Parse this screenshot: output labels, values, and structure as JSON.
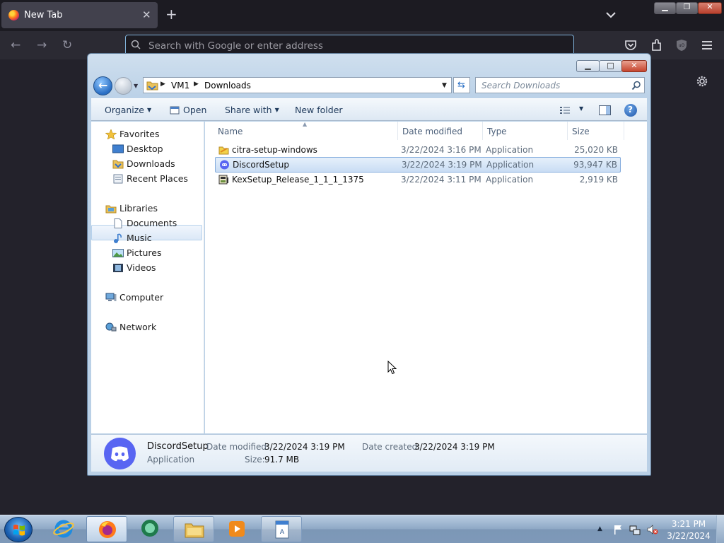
{
  "browser": {
    "tab_title": "New Tab",
    "tab_close": "✕",
    "new_tab": "+",
    "url_placeholder": "Search with Google or enter address"
  },
  "explorer": {
    "breadcrumb": [
      "VM1",
      "Downloads"
    ],
    "search_placeholder": "Search Downloads",
    "toolbar": {
      "organize": "Organize",
      "open": "Open",
      "share_with": "Share with",
      "new_folder": "New folder"
    },
    "nav": {
      "favorites": "Favorites",
      "desktop": "Desktop",
      "downloads": "Downloads",
      "recent_places": "Recent Places",
      "libraries": "Libraries",
      "documents": "Documents",
      "music": "Music",
      "pictures": "Pictures",
      "videos": "Videos",
      "computer": "Computer",
      "network": "Network"
    },
    "columns": [
      "Name",
      "Date modified",
      "Type",
      "Size"
    ],
    "files": [
      {
        "name": "citra-setup-windows",
        "date": "3/22/2024 3:16 PM",
        "type": "Application",
        "size": "25,020 KB",
        "icon": "citra-icon"
      },
      {
        "name": "DiscordSetup",
        "date": "3/22/2024 3:19 PM",
        "type": "Application",
        "size": "93,947 KB",
        "icon": "discord-icon",
        "selected": true
      },
      {
        "name": "KexSetup_Release_1_1_1_1375",
        "date": "3/22/2024 3:11 PM",
        "type": "Application",
        "size": "2,919 KB",
        "icon": "installer-icon"
      }
    ],
    "details": {
      "name": "DiscordSetup",
      "type": "Application",
      "date_modified_label": "Date modified:",
      "date_modified": "3/22/2024 3:19 PM",
      "date_created_label": "Date created:",
      "date_created": "3/22/2024 3:19 PM",
      "size_label": "Size:",
      "size": "91.7 MB"
    }
  },
  "taskbar": {
    "time": "3:21 PM",
    "date": "3/22/2024"
  },
  "colors": {
    "selection": "#c9ddf4",
    "discord": "#5865f2",
    "firefox_bg": "#23222b"
  }
}
